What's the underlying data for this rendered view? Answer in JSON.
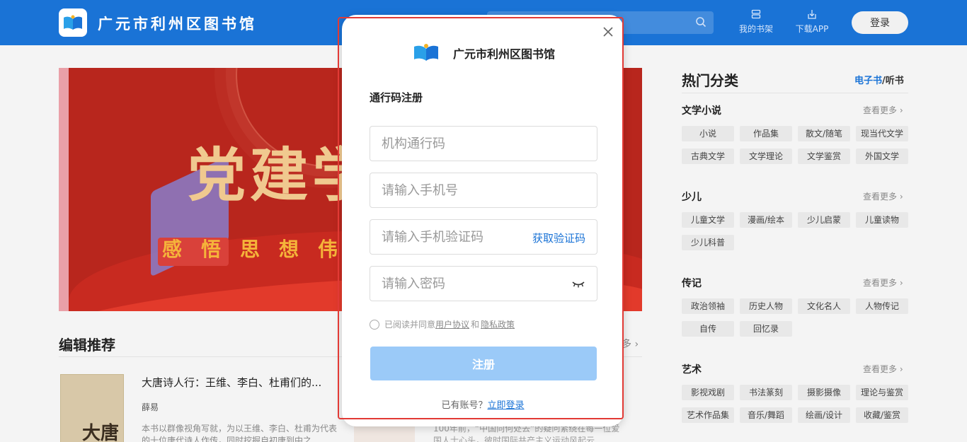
{
  "header": {
    "site_title": "广元市利州区图书馆",
    "links": [
      {
        "label": "我的书架",
        "icon": "bookshelf-icon"
      },
      {
        "label": "下载APP",
        "icon": "download-icon"
      }
    ],
    "login_label": "登录",
    "colors": {
      "bar": "#1a73d6"
    }
  },
  "banner": {
    "title": "党建学",
    "subtitle": "感悟思想伟"
  },
  "editor_section": {
    "title": "编辑推荐",
    "more": "多",
    "book": {
      "title": "大唐诗人行：王维、李白、杜甫们的...",
      "author": "薛易",
      "description": "本书以群像视角写就，为以王维、李白、杜甫为代表的十位唐代诗人作传，同时挖掘自初唐到中之",
      "cover_text": "大唐"
    },
    "book2_description": "100年前，“中国向何处去”的疑问紧绕在每一位爱国人士心头，彼时国际共产主义运动风起云"
  },
  "hot": {
    "title": "热门分类",
    "tab_ebook": "电子书",
    "tab_sep": "/",
    "tab_audio": "听书",
    "more_label": "查看更多 ›",
    "categories": [
      {
        "name": "文学小说",
        "tags": [
          "小说",
          "作品集",
          "散文/随笔",
          "现当代文学",
          "古典文学",
          "文学理论",
          "文学鉴赏",
          "外国文学"
        ]
      },
      {
        "name": "少儿",
        "tags": [
          "儿童文学",
          "漫画/绘本",
          "少儿启蒙",
          "儿童读物",
          "少儿科普"
        ]
      },
      {
        "name": "传记",
        "tags": [
          "政治领袖",
          "历史人物",
          "文化名人",
          "人物传记",
          "自传",
          "回忆录"
        ]
      },
      {
        "name": "艺术",
        "tags": [
          "影视戏剧",
          "书法篆刻",
          "摄影摄像",
          "理论与鉴赏",
          "艺术作品集",
          "音乐/舞蹈",
          "绘画/设计",
          "收藏/鉴赏"
        ]
      }
    ]
  },
  "modal": {
    "brand": "广元市利州区图书馆",
    "heading": "通行码注册",
    "fields": {
      "org_code_placeholder": "机构通行码",
      "phone_placeholder": "请输入手机号",
      "sms_placeholder": "请输入手机验证码",
      "password_placeholder": "请输入密码"
    },
    "get_code_label": "获取验证码",
    "agree_prefix": "已阅读并同意",
    "agree_terms": "用户协议",
    "agree_and": "和",
    "agree_privacy": "隐私政策",
    "register_label": "注册",
    "has_account": "已有账号？",
    "login_now": "立即登录",
    "colors": {
      "button_disabled": "#9bcaf8",
      "link": "#1a73d6",
      "highlight_border": "#e23a35"
    }
  }
}
